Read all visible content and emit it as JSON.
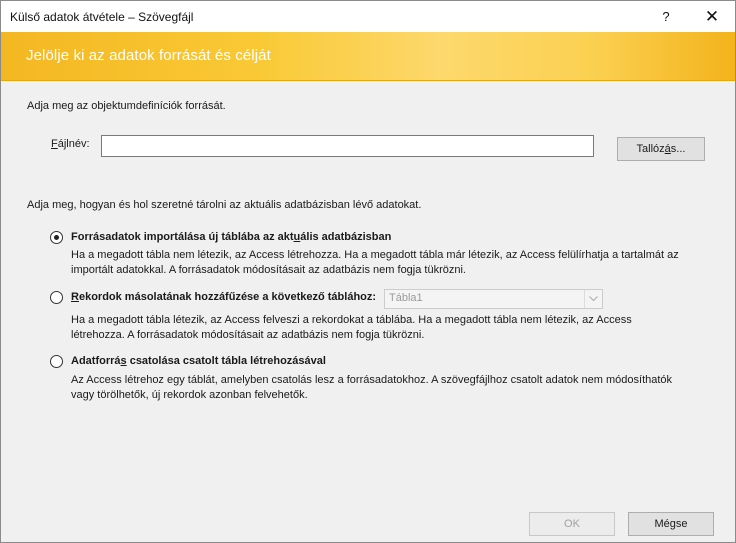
{
  "window": {
    "title": "Külső adatok átvétele – Szövegfájl",
    "help_symbol": "?",
    "close_symbol": "✕"
  },
  "banner": {
    "heading": "Jelölje ki az adatok forrását és célját"
  },
  "source": {
    "prompt": "Adja meg az objektumdefiníciók forrását.",
    "filename_label_pre": "",
    "filename_label_u": "F",
    "filename_label_post": "ájlnév:",
    "filename_value": "",
    "browse_pre": "Tallóz",
    "browse_u": "á",
    "browse_post": "s..."
  },
  "storage": {
    "prompt": "Adja meg, hogyan és hol szeretné tárolni az aktuális adatbázisban lévő adatokat.",
    "options": [
      {
        "selected": true,
        "label_pre": "Forrásadatok importálása új táblába az akt",
        "label_u": "u",
        "label_post": "ális adatbázisban",
        "desc_1": "Ha a megadott tábla nem létezik, az Access létrehozza. Ha a megadott tábla már létezik, az Access felülírhatja a tartalmát az",
        "desc_2": "importált adatokkal. A forrásadatok módosításait az adatbázis nem fogja tükrözni."
      },
      {
        "selected": false,
        "label_pre": "",
        "label_u": "R",
        "label_post": "ekordok másolatának hozzáfűzése a következő táblához:",
        "table_select_value": "Tábla1",
        "desc_1": "Ha a megadott tábla létezik, az Access felveszi a rekordokat a táblába. Ha a megadott tábla nem létezik, az Access",
        "desc_2": "létrehozza. A forrásadatok módosításait az adatbázis nem fogja tükrözni."
      },
      {
        "selected": false,
        "label_pre": "Adatforrá",
        "label_u": "s",
        "label_post": " csatolása csatolt tábla létrehozásával",
        "desc_1": "Az Access létrehoz egy táblát, amelyben csatolás lesz a forrásadatokhoz. A szövegfájlhoz csatolt adatok nem módosíthatók",
        "desc_2": "vagy törölhetők, új rekordok azonban felvehetők."
      }
    ]
  },
  "footer": {
    "ok_label": "OK",
    "cancel_label": "Mégse"
  },
  "colors": {
    "banner": "#f9c935",
    "banner_text": "#ffffff",
    "background": "#f0f0f0"
  }
}
